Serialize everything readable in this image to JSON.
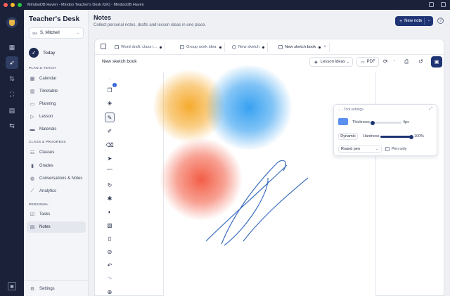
{
  "window": {
    "title": "MindooDB Haven - Mindoo Teacher's Desk (UK) - MindooDB Haven",
    "colors": {
      "close": "#ff5f57",
      "minimize": "#febc2e",
      "maximize": "#28c840"
    }
  },
  "rail": {
    "icons": [
      "logo-shield",
      "dashboard-icon",
      "rocket-icon",
      "transfer-icon",
      "scan-icon",
      "calendar-grid-icon",
      "sliders-icon"
    ]
  },
  "sidebar": {
    "brand": "Teacher's Desk",
    "user": {
      "initials": "SM",
      "name": "S. Mitchell"
    },
    "today": "Today",
    "sections": [
      {
        "title": "PLAN & TEACH",
        "items": [
          "Calendar",
          "Timetable",
          "Planning",
          "Lesson",
          "Materials"
        ]
      },
      {
        "title": "CLASS & PROGRESS",
        "items": [
          "Classes",
          "Grades",
          "Conversations & Notes",
          "Analytics"
        ]
      },
      {
        "title": "PERSONAL",
        "items": [
          "Tasks",
          "Notes"
        ]
      }
    ],
    "active_item": "Notes",
    "settings": "Settings"
  },
  "header": {
    "title": "Notes",
    "subtitle": "Collect personal notes, drafts and lesson ideas in one place.",
    "new_note": "New note"
  },
  "tabs": [
    {
      "label": "Word draft: class i...",
      "dirty": true
    },
    {
      "label": "Group work idea",
      "dirty": true
    },
    {
      "label": "New sketch",
      "dirty": true
    },
    {
      "label": "New sketch book",
      "dirty": true,
      "active": true
    }
  ],
  "doc": {
    "title": "New sketch book",
    "category": "Lesson ideas",
    "pdf": "PDF"
  },
  "tools": {
    "badge_count": "1",
    "items": [
      "pages-icon",
      "layers-icon",
      "pen-icon",
      "highlighter-icon",
      "eraser-icon",
      "select-icon",
      "curve-icon",
      "rotate-icon",
      "sparkle-icon",
      "palette-icon",
      "image-icon",
      "page-icon",
      "attach-icon",
      "undo-icon",
      "redo-icon",
      "zoom-in-icon"
    ],
    "active": "pen-icon"
  },
  "tool_settings": {
    "title": "Tool settings",
    "color": "#5b8ff0",
    "thickness_label": "Thickness",
    "thickness_value": "4px",
    "thickness_level": 0.05,
    "dynamic_label": "Dynamic",
    "hardness_label": "Hardness",
    "hardness_value": "100%",
    "hardness_level": 1.0,
    "brush": "Round pen",
    "pen_only_label": "Pen only",
    "pen_only": false
  },
  "sketch": {
    "blobs": [
      {
        "color": "#f5a623",
        "name": "orange-blob"
      },
      {
        "color": "#2d9cf0",
        "name": "blue-blob"
      },
      {
        "color": "#f2553c",
        "name": "red-blob"
      }
    ],
    "stroke_color": "#3d6fbf"
  }
}
